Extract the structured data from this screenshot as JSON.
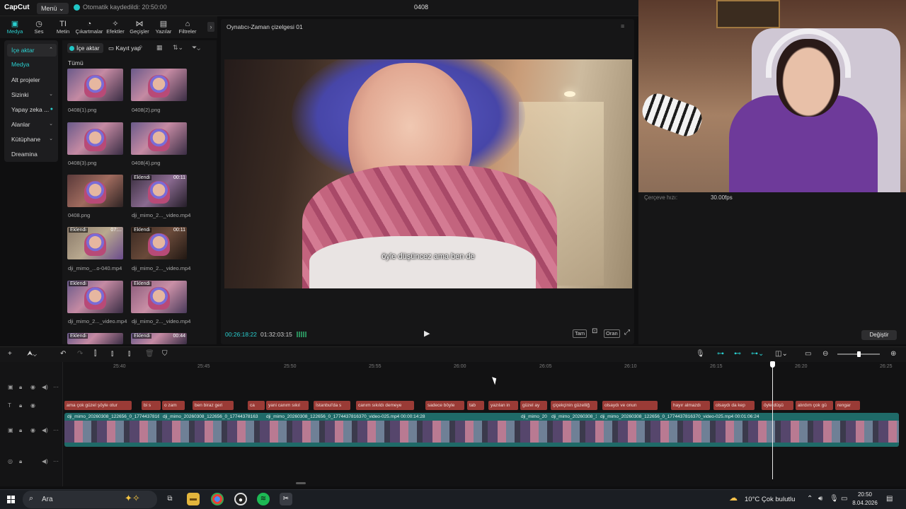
{
  "app": {
    "logo": "CapCut",
    "menu_label": "Menü ⌄",
    "autosave": "Otomatik kaydedildi: 20:50:00",
    "project_title": "0408"
  },
  "tabs": [
    {
      "label": "Medya",
      "icon": "media-icon",
      "glyph": "▣"
    },
    {
      "label": "Ses",
      "icon": "audio-icon",
      "glyph": "◷"
    },
    {
      "label": "Metin",
      "icon": "text-icon",
      "glyph": "TI"
    },
    {
      "label": "Çıkartmalar",
      "icon": "sticker-icon",
      "glyph": "◔"
    },
    {
      "label": "Efektler",
      "icon": "effects-icon",
      "glyph": "✧"
    },
    {
      "label": "Geçişler",
      "icon": "transition-icon",
      "glyph": "⋈"
    },
    {
      "label": "Yazılar",
      "icon": "captions-icon",
      "glyph": "▤"
    },
    {
      "label": "Filtreler",
      "icon": "filter-icon",
      "glyph": "⌂"
    }
  ],
  "sidebar": {
    "items": [
      {
        "label": "İçe aktar",
        "chev": "⌃"
      },
      {
        "label": "Medya",
        "chev": ""
      },
      {
        "label": "Alt projeler",
        "chev": ""
      },
      {
        "label": "Sizinki",
        "chev": "⌄"
      },
      {
        "label": "Yapay zeka ...",
        "chev": "●"
      },
      {
        "label": "Alanlar",
        "chev": "⌄"
      },
      {
        "label": "Kütüphane",
        "chev": "⌄"
      },
      {
        "label": "Dreamina",
        "chev": ""
      }
    ]
  },
  "media": {
    "import_label": "İçe aktar",
    "record_label": "Kayıt yap",
    "all_label": "Tümü",
    "items": [
      {
        "label": "0408(1).png",
        "badge": "",
        "dur": ""
      },
      {
        "label": "0408(2).png",
        "badge": "",
        "dur": ""
      },
      {
        "label": "0408(3).png",
        "badge": "",
        "dur": ""
      },
      {
        "label": "0408(4).png",
        "badge": "",
        "dur": ""
      },
      {
        "label": "0408.png",
        "badge": "",
        "dur": ""
      },
      {
        "label": "dji_mimo_2..._video.mp4",
        "badge": "Eklendi",
        "dur": "00:11"
      },
      {
        "label": "dji_mimo_...o-040.mp4",
        "badge": "Eklendi",
        "dur": "07:..."
      },
      {
        "label": "dji_mimo_2..._video.mp4",
        "badge": "Eklendi",
        "dur": "00:11"
      },
      {
        "label": "dji_mimo_2..._video.mp4",
        "badge": "Eklendi",
        "dur": ""
      },
      {
        "label": "dji_mimo_2..._video.mp4",
        "badge": "Eklendi",
        "dur": ""
      },
      {
        "label": "",
        "badge": "Eklendi",
        "dur": ""
      },
      {
        "label": "",
        "badge": "Eklendi",
        "dur": "00:44"
      }
    ]
  },
  "player": {
    "title": "Oynatıcı-Zaman çizelgesi 01",
    "subtitle": "öyle düşüncez ama ben de",
    "current_time": "00:26:18:22",
    "total_time": "01:32:03:15",
    "full_label": "Tam",
    "ratio_label": "Oran"
  },
  "details": {
    "fps_label": "Çerçeve hızı:",
    "fps_value": "30.00fps",
    "change_label": "Değiştir"
  },
  "timeline": {
    "ruler": [
      "25:40",
      "25:45",
      "25:50",
      "25:55",
      "26:00",
      "26:05",
      "26:10",
      "26:15",
      "26:20",
      "26:25"
    ],
    "subtitle_clips": [
      "ama çok güzel şöyle otur",
      "bi s",
      "o zam",
      "ben biraz geri",
      "ca",
      "yani canım sıkıl",
      "İstanbul'da s",
      "canım sıkıldı demeye",
      "sadece böyle",
      "tab",
      "yazılan in",
      "güzel ay",
      "çiçekçinin güzelliğ",
      "olsaydı ve onun",
      "hayır almazdı",
      "olsaydı da kep",
      "öyle düşü",
      "alırdım çok gü",
      "rengar"
    ],
    "video_clips": [
      "dji_mimo_20260308_122656_0_1774437816",
      "dji_mimo_20260308_122656_0_17744378163",
      "dji_mimo_20260308_122656_0_1774437816370_video-025.mp4   00:00:14:28",
      "dji_mimo_20",
      "dji_mimo_20260308_1",
      "dji_mimo_20260308_122656_0_1774437816370_video-025.mp4   00:01:06:24"
    ]
  },
  "taskbar": {
    "search_placeholder": "Ara",
    "weather": "10°C  Çok bulutlu",
    "time": "20:50",
    "date": "8.04.2026"
  },
  "colors": {
    "accent": "#2ad0d0",
    "subtitle_clip": "#9a3b36",
    "video_clip": "#1f6a68"
  }
}
